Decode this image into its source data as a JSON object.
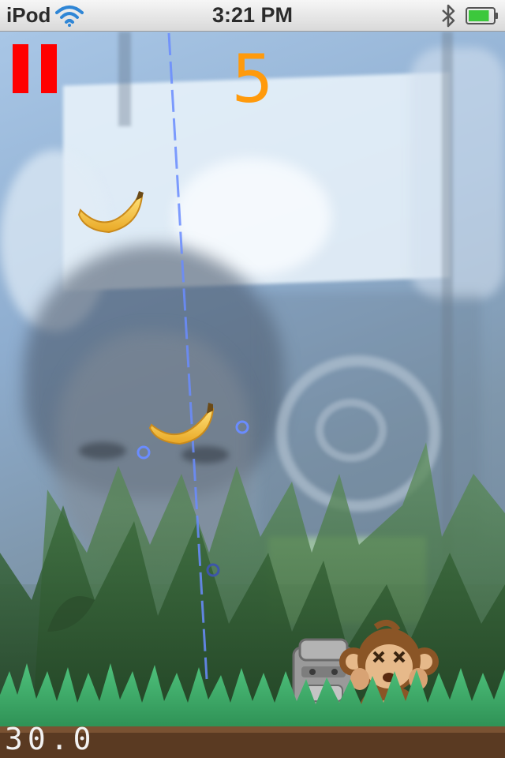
{
  "status_bar": {
    "carrier": "iPod",
    "time": "3:21 PM",
    "wifi_icon": "wifi-icon",
    "bluetooth_icon": "bluetooth-icon",
    "battery_icon": "battery-icon",
    "battery_level": 0.85
  },
  "hud": {
    "score": "5",
    "timer": "30.0",
    "pause_icon": "pause-icon",
    "pause_color": "#ff0000",
    "score_color": "#ff9a0c"
  },
  "sprites": {
    "banana_color": "#f7c43a",
    "monkey_state": "dizzy",
    "totem": "stone-totem"
  }
}
